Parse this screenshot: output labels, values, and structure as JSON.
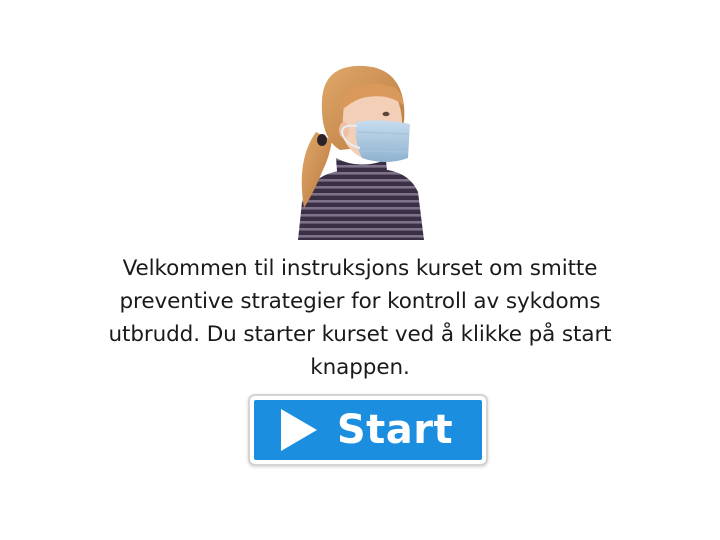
{
  "intro": {
    "image_alt": "Jente med munnbind",
    "welcome_text": "Velkommen til instruksjons kurset om smitte preventive strategier for kontroll av sykdoms utbrudd. Du starter kurset ved å klikke på start knappen."
  },
  "start_button": {
    "label": "Start",
    "icon": "play-icon",
    "color": "#1b8ee0"
  }
}
